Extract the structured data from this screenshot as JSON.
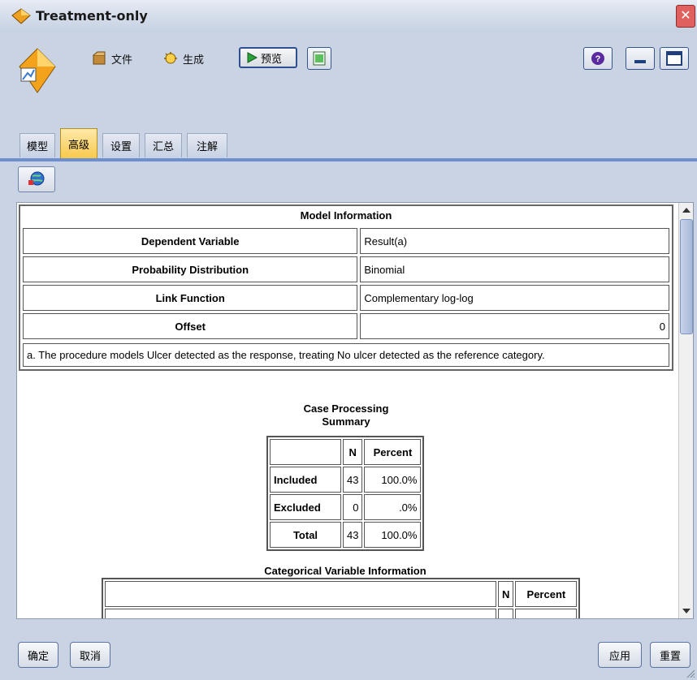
{
  "window": {
    "title": "Treatment-only",
    "close_glyph": "✕"
  },
  "toolbar": {
    "file_label": "文件",
    "generate_label": "生成",
    "preview_label": "预览"
  },
  "tabs": [
    {
      "label": "模型",
      "active": false
    },
    {
      "label": "高级",
      "active": true
    },
    {
      "label": "设置",
      "active": false
    },
    {
      "label": "汇总",
      "active": false
    },
    {
      "label": "注解",
      "active": false
    }
  ],
  "model_info": {
    "title": "Model Information",
    "rows": [
      {
        "label": "Dependent Variable",
        "value": "Result(a)"
      },
      {
        "label": "Probability Distribution",
        "value": "Binomial"
      },
      {
        "label": "Link Function",
        "value": "Complementary log-log"
      },
      {
        "label": "Offset",
        "value": "0"
      }
    ],
    "note": "a. The procedure models Ulcer detected as the response, treating No ulcer detected as the reference category."
  },
  "case_processing": {
    "title_line1": "Case Processing",
    "title_line2": "Summary",
    "header": [
      "",
      "N",
      "Percent"
    ],
    "rows": [
      {
        "label": "Included",
        "n": "43",
        "percent": "100.0%"
      },
      {
        "label": "Excluded",
        "n": "0",
        "percent": ".0%"
      },
      {
        "label": "Total",
        "n": "43",
        "percent": "100.0%"
      }
    ]
  },
  "categorical_info": {
    "title": "Categorical Variable Information",
    "header": [
      "",
      "N",
      "Percent"
    ]
  },
  "footer": {
    "ok_label": "确定",
    "cancel_label": "取消",
    "apply_label": "应用",
    "reset_label": "重置"
  },
  "colors": {
    "active_tab": "#f7c84a",
    "tab_line": "#6d8fcf",
    "background": "#c9d3e3"
  }
}
